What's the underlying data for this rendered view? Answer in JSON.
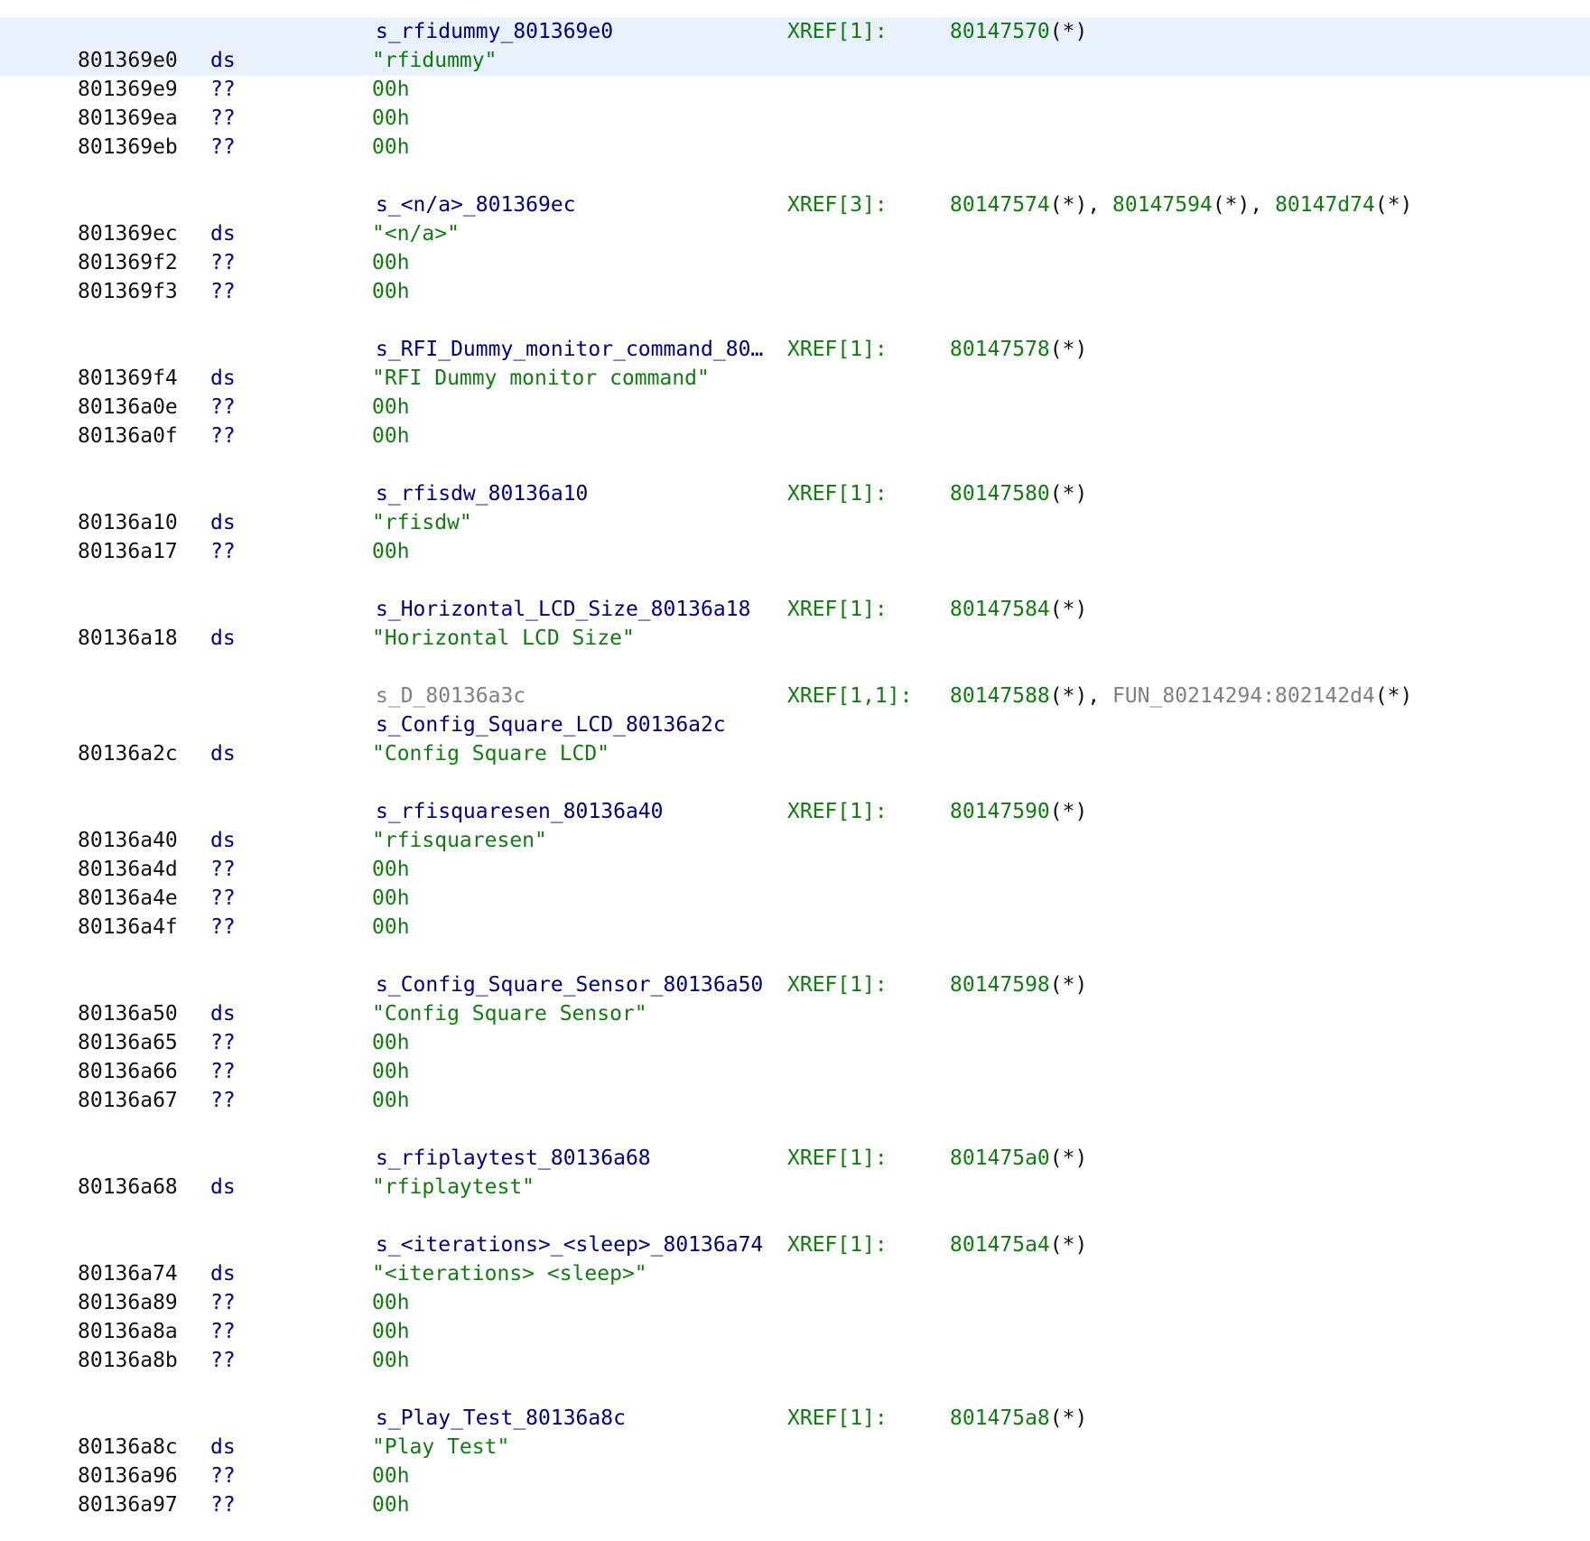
{
  "colors": {
    "background": "#ffffff",
    "selection": "#e8f1fc",
    "address": "#111111",
    "mnemonic": "#00007e",
    "label": "#00007e",
    "string": "#107c10",
    "xref": "#107c10",
    "inactive_label": "#808080"
  },
  "listing": [
    {
      "kind": "label",
      "name": "s_rfidummy_801369e0",
      "xref": "XREF[1]:",
      "refs": [
        {
          "addr": "80147570",
          "suffix": "(*)"
        }
      ]
    },
    {
      "kind": "data",
      "addr": "801369e0",
      "mnem": "ds",
      "operand": "\"rfidummy\"",
      "otype": "str"
    },
    {
      "kind": "data",
      "addr": "801369e9",
      "mnem": "??",
      "operand": "00h",
      "otype": "num"
    },
    {
      "kind": "data",
      "addr": "801369ea",
      "mnem": "??",
      "operand": "00h",
      "otype": "num"
    },
    {
      "kind": "data",
      "addr": "801369eb",
      "mnem": "??",
      "operand": "00h",
      "otype": "num"
    },
    {
      "kind": "gap"
    },
    {
      "kind": "label",
      "name": "s_<n/a>_801369ec",
      "xref": "XREF[3]:",
      "refs": [
        {
          "addr": "80147574",
          "suffix": "(*)"
        },
        {
          "addr": "80147594",
          "suffix": "(*)"
        },
        {
          "addr": "80147d74",
          "suffix": "(*)"
        }
      ]
    },
    {
      "kind": "data",
      "addr": "801369ec",
      "mnem": "ds",
      "operand": "\"<n/a>\"",
      "otype": "str"
    },
    {
      "kind": "data",
      "addr": "801369f2",
      "mnem": "??",
      "operand": "00h",
      "otype": "num"
    },
    {
      "kind": "data",
      "addr": "801369f3",
      "mnem": "??",
      "operand": "00h",
      "otype": "num"
    },
    {
      "kind": "gap"
    },
    {
      "kind": "label",
      "name": "s_RFI_Dummy_monitor_command_80…",
      "xref": "XREF[1]:",
      "refs": [
        {
          "addr": "80147578",
          "suffix": "(*)"
        }
      ]
    },
    {
      "kind": "data",
      "addr": "801369f4",
      "mnem": "ds",
      "operand": "\"RFI Dummy monitor command\"",
      "otype": "str"
    },
    {
      "kind": "data",
      "addr": "80136a0e",
      "mnem": "??",
      "operand": "00h",
      "otype": "num"
    },
    {
      "kind": "data",
      "addr": "80136a0f",
      "mnem": "??",
      "operand": "00h",
      "otype": "num"
    },
    {
      "kind": "gap"
    },
    {
      "kind": "label",
      "name": "s_rfisdw_80136a10",
      "xref": "XREF[1]:",
      "refs": [
        {
          "addr": "80147580",
          "suffix": "(*)"
        }
      ]
    },
    {
      "kind": "data",
      "addr": "80136a10",
      "mnem": "ds",
      "operand": "\"rfisdw\"",
      "otype": "str"
    },
    {
      "kind": "data",
      "addr": "80136a17",
      "mnem": "??",
      "operand": "00h",
      "otype": "num"
    },
    {
      "kind": "gap"
    },
    {
      "kind": "label",
      "name": "s_Horizontal_LCD_Size_80136a18",
      "xref": "XREF[1]:",
      "refs": [
        {
          "addr": "80147584",
          "suffix": "(*)"
        }
      ]
    },
    {
      "kind": "data",
      "addr": "80136a18",
      "mnem": "ds",
      "operand": "\"Horizontal LCD Size\"",
      "otype": "str"
    },
    {
      "kind": "gap"
    },
    {
      "kind": "label",
      "name": "s_D_80136a3c",
      "gray": true,
      "xref": "XREF[1,1]:",
      "refs": [
        {
          "addr": "80147588",
          "suffix": "(*)"
        },
        {
          "addr": "FUN_80214294:802142d4",
          "suffix": "(*)",
          "gray": true
        }
      ]
    },
    {
      "kind": "label",
      "name": "s_Config_Square_LCD_80136a2c"
    },
    {
      "kind": "data",
      "addr": "80136a2c",
      "mnem": "ds",
      "operand": "\"Config Square LCD\"",
      "otype": "str"
    },
    {
      "kind": "gap"
    },
    {
      "kind": "label",
      "name": "s_rfisquaresen_80136a40",
      "xref": "XREF[1]:",
      "refs": [
        {
          "addr": "80147590",
          "suffix": "(*)"
        }
      ]
    },
    {
      "kind": "data",
      "addr": "80136a40",
      "mnem": "ds",
      "operand": "\"rfisquaresen\"",
      "otype": "str"
    },
    {
      "kind": "data",
      "addr": "80136a4d",
      "mnem": "??",
      "operand": "00h",
      "otype": "num"
    },
    {
      "kind": "data",
      "addr": "80136a4e",
      "mnem": "??",
      "operand": "00h",
      "otype": "num"
    },
    {
      "kind": "data",
      "addr": "80136a4f",
      "mnem": "??",
      "operand": "00h",
      "otype": "num"
    },
    {
      "kind": "gap"
    },
    {
      "kind": "label",
      "name": "s_Config_Square_Sensor_80136a50",
      "xref": "XREF[1]:",
      "refs": [
        {
          "addr": "80147598",
          "suffix": "(*)"
        }
      ]
    },
    {
      "kind": "data",
      "addr": "80136a50",
      "mnem": "ds",
      "operand": "\"Config Square Sensor\"",
      "otype": "str"
    },
    {
      "kind": "data",
      "addr": "80136a65",
      "mnem": "??",
      "operand": "00h",
      "otype": "num"
    },
    {
      "kind": "data",
      "addr": "80136a66",
      "mnem": "??",
      "operand": "00h",
      "otype": "num"
    },
    {
      "kind": "data",
      "addr": "80136a67",
      "mnem": "??",
      "operand": "00h",
      "otype": "num"
    },
    {
      "kind": "gap"
    },
    {
      "kind": "label",
      "name": "s_rfiplaytest_80136a68",
      "xref": "XREF[1]:",
      "refs": [
        {
          "addr": "801475a0",
          "suffix": "(*)"
        }
      ]
    },
    {
      "kind": "data",
      "addr": "80136a68",
      "mnem": "ds",
      "operand": "\"rfiplaytest\"",
      "otype": "str"
    },
    {
      "kind": "gap"
    },
    {
      "kind": "label",
      "name": "s_<iterations>_<sleep>_80136a74",
      "xref": "XREF[1]:",
      "refs": [
        {
          "addr": "801475a4",
          "suffix": "(*)"
        }
      ]
    },
    {
      "kind": "data",
      "addr": "80136a74",
      "mnem": "ds",
      "operand": "\"<iterations> <sleep>\"",
      "otype": "str"
    },
    {
      "kind": "data",
      "addr": "80136a89",
      "mnem": "??",
      "operand": "00h",
      "otype": "num"
    },
    {
      "kind": "data",
      "addr": "80136a8a",
      "mnem": "??",
      "operand": "00h",
      "otype": "num"
    },
    {
      "kind": "data",
      "addr": "80136a8b",
      "mnem": "??",
      "operand": "00h",
      "otype": "num"
    },
    {
      "kind": "gap"
    },
    {
      "kind": "label",
      "name": "s_Play_Test_80136a8c",
      "xref": "XREF[1]:",
      "refs": [
        {
          "addr": "801475a8",
          "suffix": "(*)"
        }
      ]
    },
    {
      "kind": "data",
      "addr": "80136a8c",
      "mnem": "ds",
      "operand": "\"Play Test\"",
      "otype": "str"
    },
    {
      "kind": "data",
      "addr": "80136a96",
      "mnem": "??",
      "operand": "00h",
      "otype": "num"
    },
    {
      "kind": "data",
      "addr": "80136a97",
      "mnem": "??",
      "operand": "00h",
      "otype": "num"
    }
  ]
}
